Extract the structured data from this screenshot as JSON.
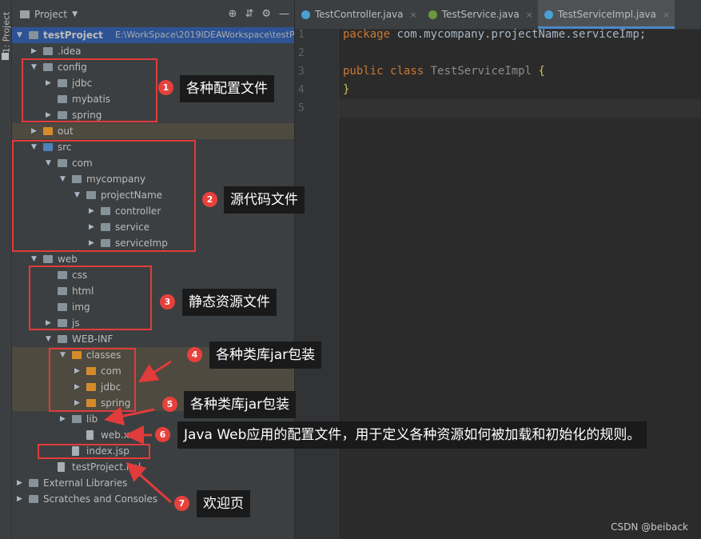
{
  "sidebar_tab": {
    "label": "1: Project"
  },
  "project_panel": {
    "title": "Project"
  },
  "tree": [
    {
      "label": "testProject",
      "path": "E:\\WorkSpace\\2019IDEAWorkspace\\testP",
      "depth": 0,
      "arrow": "down",
      "icon": "grey",
      "bold": true,
      "state": "selected"
    },
    {
      "label": ".idea",
      "depth": 1,
      "arrow": "right",
      "icon": "grey"
    },
    {
      "label": "config",
      "depth": 1,
      "arrow": "down",
      "icon": "grey"
    },
    {
      "label": "jdbc",
      "depth": 2,
      "arrow": "right",
      "icon": "grey"
    },
    {
      "label": "mybatis",
      "depth": 2,
      "arrow": "none",
      "icon": "grey"
    },
    {
      "label": "spring",
      "depth": 2,
      "arrow": "right",
      "icon": "grey"
    },
    {
      "label": "out",
      "depth": 1,
      "arrow": "right",
      "icon": "orange",
      "state": "excluded"
    },
    {
      "label": "src",
      "depth": 1,
      "arrow": "down",
      "icon": "blue"
    },
    {
      "label": "com",
      "depth": 2,
      "arrow": "down",
      "icon": "grey"
    },
    {
      "label": "mycompany",
      "depth": 3,
      "arrow": "down",
      "icon": "grey"
    },
    {
      "label": "projectName",
      "depth": 4,
      "arrow": "down",
      "icon": "grey"
    },
    {
      "label": "controller",
      "depth": 5,
      "arrow": "right",
      "icon": "grey"
    },
    {
      "label": "service",
      "depth": 5,
      "arrow": "right",
      "icon": "grey"
    },
    {
      "label": "serviceImp",
      "depth": 5,
      "arrow": "right",
      "icon": "grey"
    },
    {
      "label": "web",
      "depth": 1,
      "arrow": "down",
      "icon": "grey"
    },
    {
      "label": "css",
      "depth": 2,
      "arrow": "none",
      "icon": "grey"
    },
    {
      "label": "html",
      "depth": 2,
      "arrow": "none",
      "icon": "grey"
    },
    {
      "label": "img",
      "depth": 2,
      "arrow": "none",
      "icon": "grey"
    },
    {
      "label": "js",
      "depth": 2,
      "arrow": "right",
      "icon": "grey"
    },
    {
      "label": "WEB-INF",
      "depth": 2,
      "arrow": "down",
      "icon": "grey"
    },
    {
      "label": "classes",
      "depth": 3,
      "arrow": "down",
      "icon": "orange",
      "state": "excluded"
    },
    {
      "label": "com",
      "depth": 4,
      "arrow": "right",
      "icon": "orange",
      "state": "excluded"
    },
    {
      "label": "jdbc",
      "depth": 4,
      "arrow": "right",
      "icon": "orange",
      "state": "excluded"
    },
    {
      "label": "spring",
      "depth": 4,
      "arrow": "right",
      "icon": "orange",
      "state": "excluded"
    },
    {
      "label": "lib",
      "depth": 3,
      "arrow": "right",
      "icon": "grey"
    },
    {
      "label": "web.xml",
      "depth": 4,
      "arrow": "none",
      "icon": "file"
    },
    {
      "label": "index.jsp",
      "depth": 3,
      "arrow": "none",
      "icon": "file"
    },
    {
      "label": "testProject.iml",
      "depth": 2,
      "arrow": "none",
      "icon": "file"
    },
    {
      "label": "External Libraries",
      "depth": 0,
      "arrow": "right",
      "icon": "grey"
    },
    {
      "label": "Scratches and Consoles",
      "depth": 0,
      "arrow": "right",
      "icon": "grey"
    }
  ],
  "tabs": [
    {
      "label": "TestController.java",
      "icon_color": "#4a9fd5",
      "active": false
    },
    {
      "label": "TestService.java",
      "icon_color": "#6a9a3c",
      "active": false
    },
    {
      "label": "TestServiceImpl.java",
      "icon_color": "#4a9fd5",
      "active": true
    }
  ],
  "editor": {
    "line_numbers": [
      "1",
      "2",
      "3",
      "4",
      "5"
    ],
    "line1": {
      "kw": "package",
      "rest": " com.mycompany.projectName.serviceImp;"
    },
    "line3": {
      "kw1": "public",
      "kw2": "class",
      "cls": "TestServiceImpl",
      "brace": "{"
    },
    "line4": {
      "brace": "}"
    }
  },
  "annotations": [
    {
      "n": "1",
      "text": "各种配置文件"
    },
    {
      "n": "2",
      "text": "源代码文件"
    },
    {
      "n": "3",
      "text": "静态资源文件"
    },
    {
      "n": "4",
      "text": "各种类库jar包装"
    },
    {
      "n": "5",
      "text": "各种类库jar包装"
    },
    {
      "n": "6",
      "text": "Java Web应用的配置文件，用于定义各种资源如何被加载和初始化的规则。"
    },
    {
      "n": "7",
      "text": "欢迎页"
    }
  ],
  "watermark": "CSDN @beiback",
  "colors": {
    "accent": "#4a88c7",
    "annotation_red": "#e23b3b",
    "selection": "#2d5394"
  }
}
